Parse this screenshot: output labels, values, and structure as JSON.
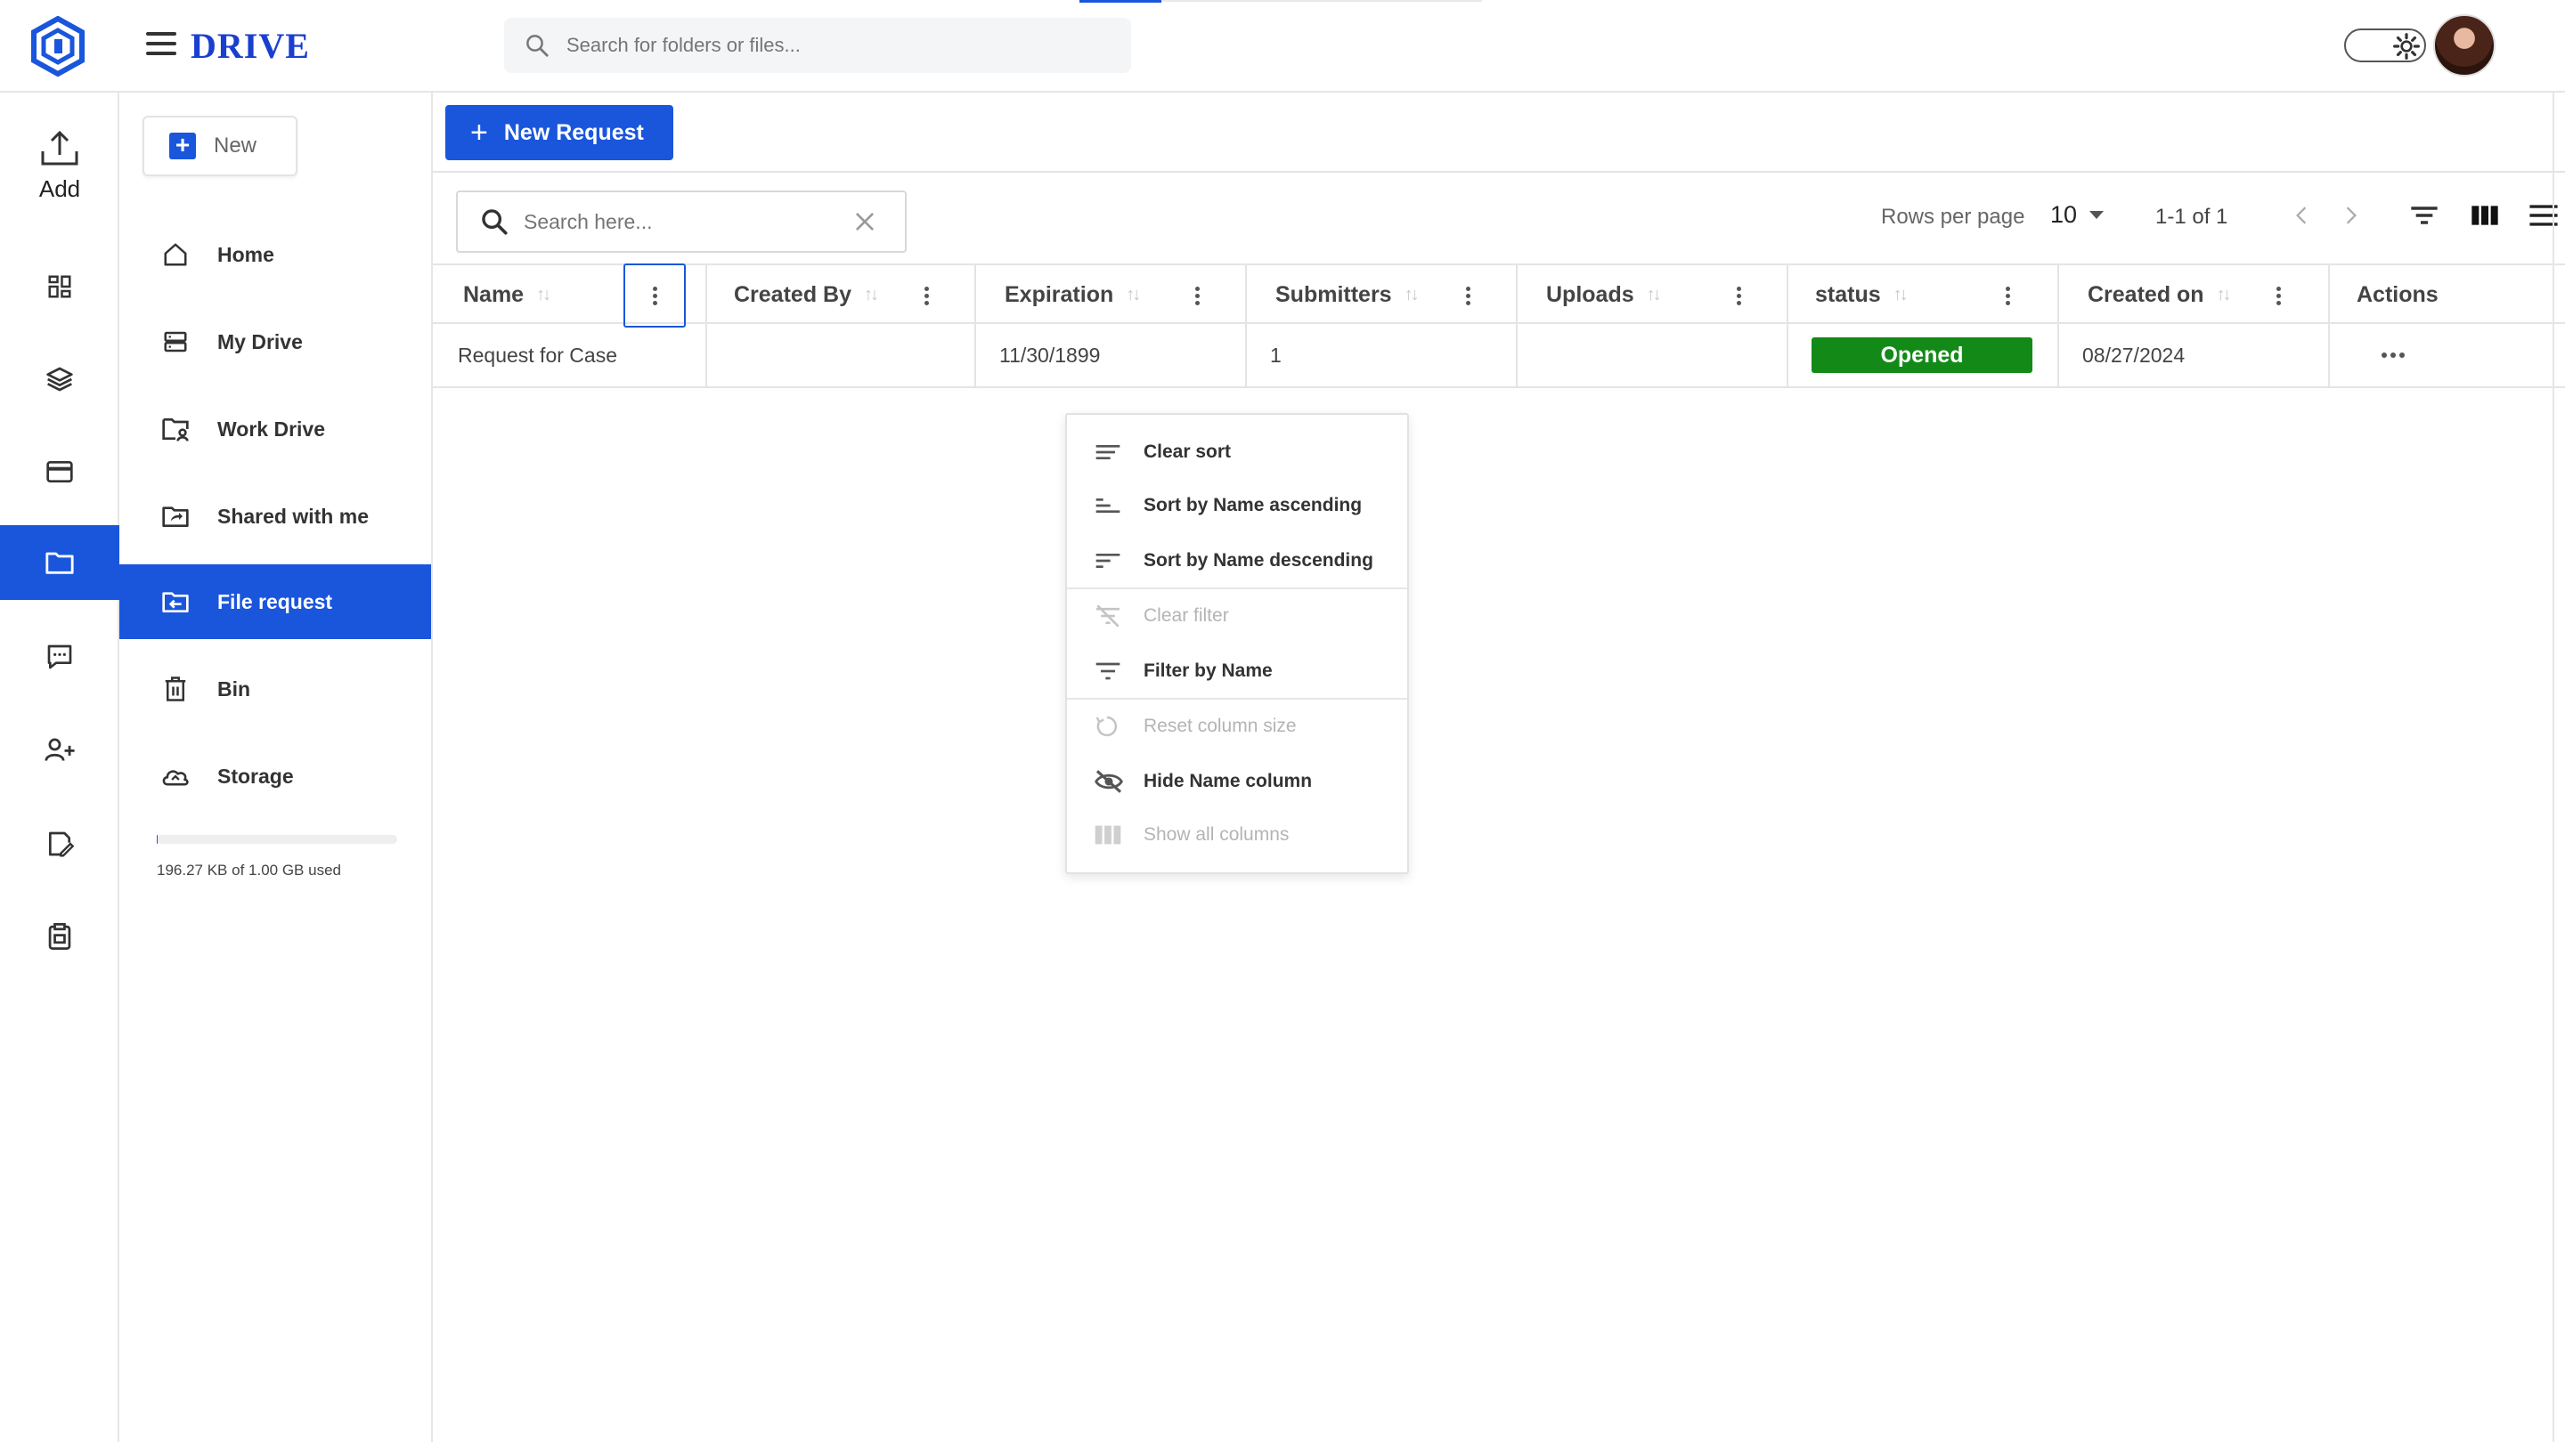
{
  "header": {
    "brand": "DRIVE",
    "search_placeholder": "Search for folders or files..."
  },
  "rail": {
    "add_label": "Add"
  },
  "sidebar": {
    "new_label": "New",
    "items": [
      {
        "label": "Home",
        "icon": "home-icon"
      },
      {
        "label": "My Drive",
        "icon": "drive-icon"
      },
      {
        "label": "Work Drive",
        "icon": "work-drive-icon"
      },
      {
        "label": "Shared with me",
        "icon": "shared-folder-icon"
      },
      {
        "label": "File request",
        "icon": "file-request-icon"
      },
      {
        "label": "Bin",
        "icon": "trash-icon"
      },
      {
        "label": "Storage",
        "icon": "cloud-icon"
      }
    ],
    "active": "File request",
    "storage_used": "196.27 KB of 1.00 GB used"
  },
  "toolbar": {
    "new_request_label": "New Request",
    "search_placeholder": "Search here...",
    "rows_per_page_label": "Rows per page",
    "rows_per_page_value": "10",
    "pagination": "1-1 of 1"
  },
  "table": {
    "columns": [
      "Name",
      "Created By",
      "Expiration",
      "Submitters",
      "Uploads",
      "status",
      "Created on",
      "Actions"
    ],
    "rows": [
      {
        "name": "Request for Case",
        "created_by": "",
        "expiration": "11/30/1899",
        "submitters": "1",
        "uploads": "",
        "status": "Opened",
        "created_on": "08/27/2024"
      }
    ]
  },
  "column_menu": {
    "items": [
      {
        "label": "Clear sort",
        "enabled": true
      },
      {
        "label": "Sort by Name ascending",
        "enabled": true
      },
      {
        "label": "Sort by Name descending",
        "enabled": true
      },
      {
        "label": "Clear filter",
        "enabled": false
      },
      {
        "label": "Filter by Name",
        "enabled": true
      },
      {
        "label": "Reset column size",
        "enabled": false
      },
      {
        "label": "Hide Name column",
        "enabled": true
      },
      {
        "label": "Show all columns",
        "enabled": false
      }
    ]
  },
  "colors": {
    "accent": "#1a56db",
    "status_opened": "#138a17"
  }
}
